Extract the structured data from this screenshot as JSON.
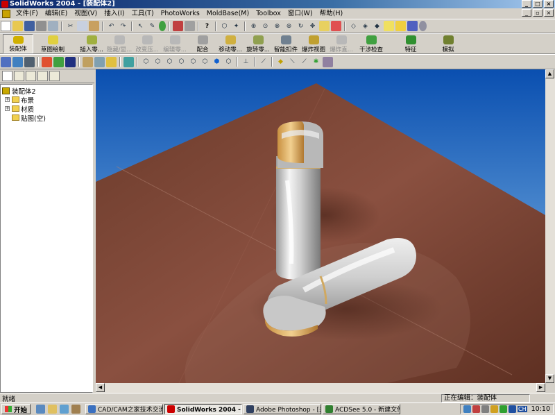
{
  "window": {
    "title": "SolidWorks 2004 - [装配体2]"
  },
  "menu": [
    "文件(F)",
    "编辑(E)",
    "视图(V)",
    "插入(I)",
    "工具(T)",
    "PhotoWorks",
    "MoldBase(M)",
    "Toolbox",
    "窗口(W)",
    "帮助(H)"
  ],
  "commands": [
    {
      "label": "装配体",
      "disabled": false,
      "pressed": true
    },
    {
      "label": "草图绘制",
      "disabled": false,
      "pressed": false
    },
    {
      "label": "插入零...",
      "disabled": false,
      "pressed": false
    },
    {
      "label": "隐藏/显...",
      "disabled": true,
      "pressed": false
    },
    {
      "label": "改变压...",
      "disabled": true,
      "pressed": false
    },
    {
      "label": "编辑零...",
      "disabled": true,
      "pressed": false
    },
    {
      "label": "配合",
      "disabled": false,
      "pressed": false
    },
    {
      "label": "移动零...",
      "disabled": false,
      "pressed": false
    },
    {
      "label": "旋转零...",
      "disabled": false,
      "pressed": false
    },
    {
      "label": "智能扣件",
      "disabled": false,
      "pressed": false
    },
    {
      "label": "爆炸视图",
      "disabled": false,
      "pressed": false
    },
    {
      "label": "爆炸直...",
      "disabled": true,
      "pressed": false
    },
    {
      "label": "干涉检查",
      "disabled": false,
      "pressed": false
    },
    {
      "label": "特征",
      "disabled": false,
      "pressed": false
    },
    {
      "label": "模拟",
      "disabled": false,
      "pressed": false
    }
  ],
  "tree": {
    "root": "装配体2",
    "items": [
      {
        "label": "布景",
        "expandable": true
      },
      {
        "label": "材质",
        "expandable": true
      },
      {
        "label": "贴图(空)",
        "expandable": false
      }
    ]
  },
  "status": {
    "left": "就绪",
    "right": "正在编辑：装配体"
  },
  "taskbar": {
    "start": "开始",
    "tasks": [
      {
        "label": "CAD/CAM之家技术交流...",
        "active": false
      },
      {
        "label": "SolidWorks 2004 - [装配...",
        "active": true
      },
      {
        "label": "Adobe Photoshop - [未标...",
        "active": false
      },
      {
        "label": "ACDSee 5.0 - 新建文件夹",
        "active": false
      }
    ],
    "lang": "CH",
    "time": "10:10"
  },
  "colors": {
    "titlebar": "#0a246a",
    "sky_top": "#0a4fb0",
    "sky_bottom": "#93c8ee",
    "floor": "#7a4636",
    "body_silver": "#d8d8d8",
    "cap_gold": "#e8c07a"
  }
}
